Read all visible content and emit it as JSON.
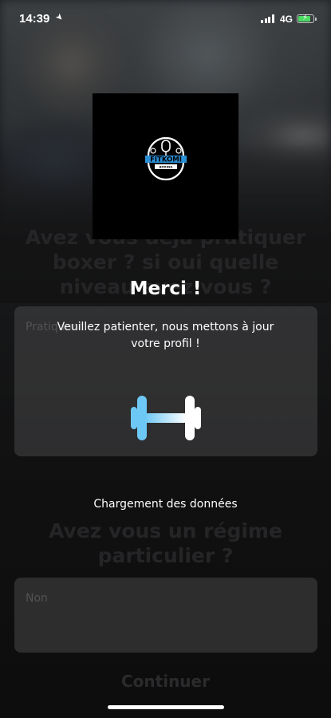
{
  "status_bar": {
    "time": "14:39",
    "network": "4G",
    "battery_level": 0.85,
    "battery_color": "#4cd964"
  },
  "logo": {
    "brand": "FITKOMI",
    "tagline": "BOXING",
    "accent_color": "#2b8fd6"
  },
  "background_form": {
    "question_1": "Avez vous déjà pratiquer boxer ? si oui quelle niveau avez vous ?",
    "field_1_placeholder": "Pratiquant",
    "question_2": "Avez vous un régime particulier ?",
    "field_2_placeholder": "Non",
    "continue_label": "Continuer"
  },
  "modal": {
    "title": "Merci !",
    "message": "Veuillez patienter, nous mettons à jour votre profil !",
    "loading_icon": "dumbbell-icon",
    "loading_text": "Chargement des données"
  }
}
